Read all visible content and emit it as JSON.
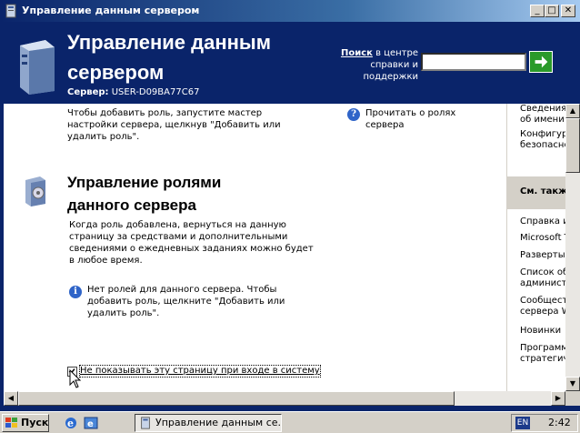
{
  "window": {
    "title": "Управление данным сервером",
    "minimize": "_",
    "maximize": "□",
    "close": "✕"
  },
  "header": {
    "title_line1": "Управление данным",
    "title_line2": "сервером",
    "server_label": "Сервер:",
    "server_name": "USER-D09BA77C67",
    "search_label_bold": "Поиск",
    "search_label_rest": " в центре справки и поддержки",
    "search_value": ""
  },
  "content": {
    "intro_text": "Чтобы добавить роль, запустите мастер настройки сервера, щелкнув \"Добавить или удалить роль\".",
    "read_roles_link": "Прочитать о ролях сервера",
    "section_title_line1": "Управление ролями",
    "section_title_line2": "данного сервера",
    "section_text": "Когда роль добавлена, вернуться на данную страницу за средствами и дополнительными сведениями о ежедневных заданиях можно будет в любое время.",
    "no_roles_text": "Нет ролей для данного сервера. Чтобы добавить роль, щелкните \"Добавить или удалить роль\".",
    "dont_show_label": "Не показывать эту страницу при входе в систему",
    "dont_show_checked": true
  },
  "sidebar": {
    "top_items": [
      "Сведения об имени до",
      "Конфигурация безопасно"
    ],
    "see_also_heading": "См. также",
    "items": [
      "Справка и",
      "Microsoft T",
      "Разверты",
      "Список об администр",
      "Сообщест сервера W",
      "Новинки",
      "Программ стратегич"
    ]
  },
  "taskbar": {
    "start_label": "Пуск",
    "task_label": "Управление данным се...",
    "language": "EN",
    "clock": "2:42"
  }
}
